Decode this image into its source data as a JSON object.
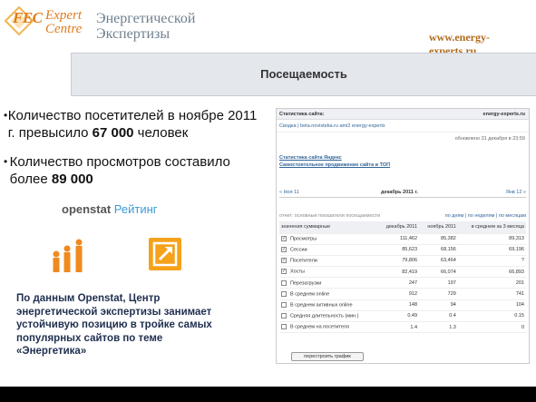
{
  "header": {
    "logo_text_1": "FEC",
    "logo_text_2": "Expert Centre",
    "org_title": "Энергетической Экспертизы",
    "site_url": "www.energy-experts.ru"
  },
  "band": {
    "title": "Посещаемость"
  },
  "bullets": [
    {
      "text_1": "Количество посетителей в ноябре 2011 г. превысило ",
      "bold": "67 000",
      "text_2": " человек"
    },
    {
      "text_1": "Количество просмотров составило более ",
      "bold": "89 000",
      "text_2": ""
    }
  ],
  "rating": {
    "brand": "openstat",
    "word": "Рейтинг"
  },
  "icons": {
    "people": "people-bars-icon",
    "arrow": "external-arrow-icon"
  },
  "note": "По данным Openstat, Центр энергетической экспертизы занимает устойчивую позицию в тройке самых популярных сайтов по теме «Энергетика»",
  "stats": {
    "title": "Статистика сайта:",
    "site": "energy-experts.ru",
    "links": "Сводка  |  beta.novisteka.ru  ami2  energy-experts",
    "updated": "обновлено 31 декабря в 23:59",
    "link_a": "Статистика сайта Яндекс",
    "link_b": "Самостоятельное продвижение сайта в ТОП",
    "nav_prev": "« Ноя 11",
    "nav_current": "декабрь 2011 г.",
    "nav_next": "Янв 12 »",
    "tabs_left": "отчет: основные показатели посещаемости",
    "tabs_right": "по дням  |  по неделям  |  по месяцам",
    "col_headers": [
      "значения суммарные",
      "декабрь 2011",
      "ноябрь 2011",
      "в среднем за 3 месяца"
    ],
    "rows": [
      {
        "label": "Просмотры",
        "checked": true,
        "dec": "111,462",
        "nov": "85,382",
        "avg": "89,313"
      },
      {
        "label": "Сессии",
        "checked": true,
        "dec": "85,623",
        "nov": "68,156",
        "avg": "69,196"
      },
      {
        "label": "Посетители",
        "checked": true,
        "dec": "79,806",
        "nov": "63,464",
        "avg": "?"
      },
      {
        "label": "Хосты",
        "checked": true,
        "dec": "82,419",
        "nov": "66,074",
        "avg": "66,893"
      },
      {
        "label": "Перезагрузки",
        "checked": false,
        "dec": "247",
        "nov": "197",
        "avg": "201"
      },
      {
        "label": "В среднем online",
        "checked": false,
        "dec": "912",
        "nov": "729",
        "avg": "741"
      },
      {
        "label": "В среднем активных online",
        "checked": false,
        "dec": "148",
        "nov": "94",
        "avg": "104"
      },
      {
        "label": "Средняя длительность (мин.)",
        "checked": false,
        "dec": "0.49",
        "nov": "0.4",
        "avg": "0.15"
      },
      {
        "label": "В среднем на посетителя",
        "checked": false,
        "dec": "1.4",
        "nov": "1.3",
        "avg": "0"
      }
    ],
    "button": "перестроить график"
  },
  "colors": {
    "accent_orange": "#f5a21b",
    "brand_orange": "#e07b1a",
    "band_bg": "#e4e7ec",
    "link_blue": "#336699"
  }
}
